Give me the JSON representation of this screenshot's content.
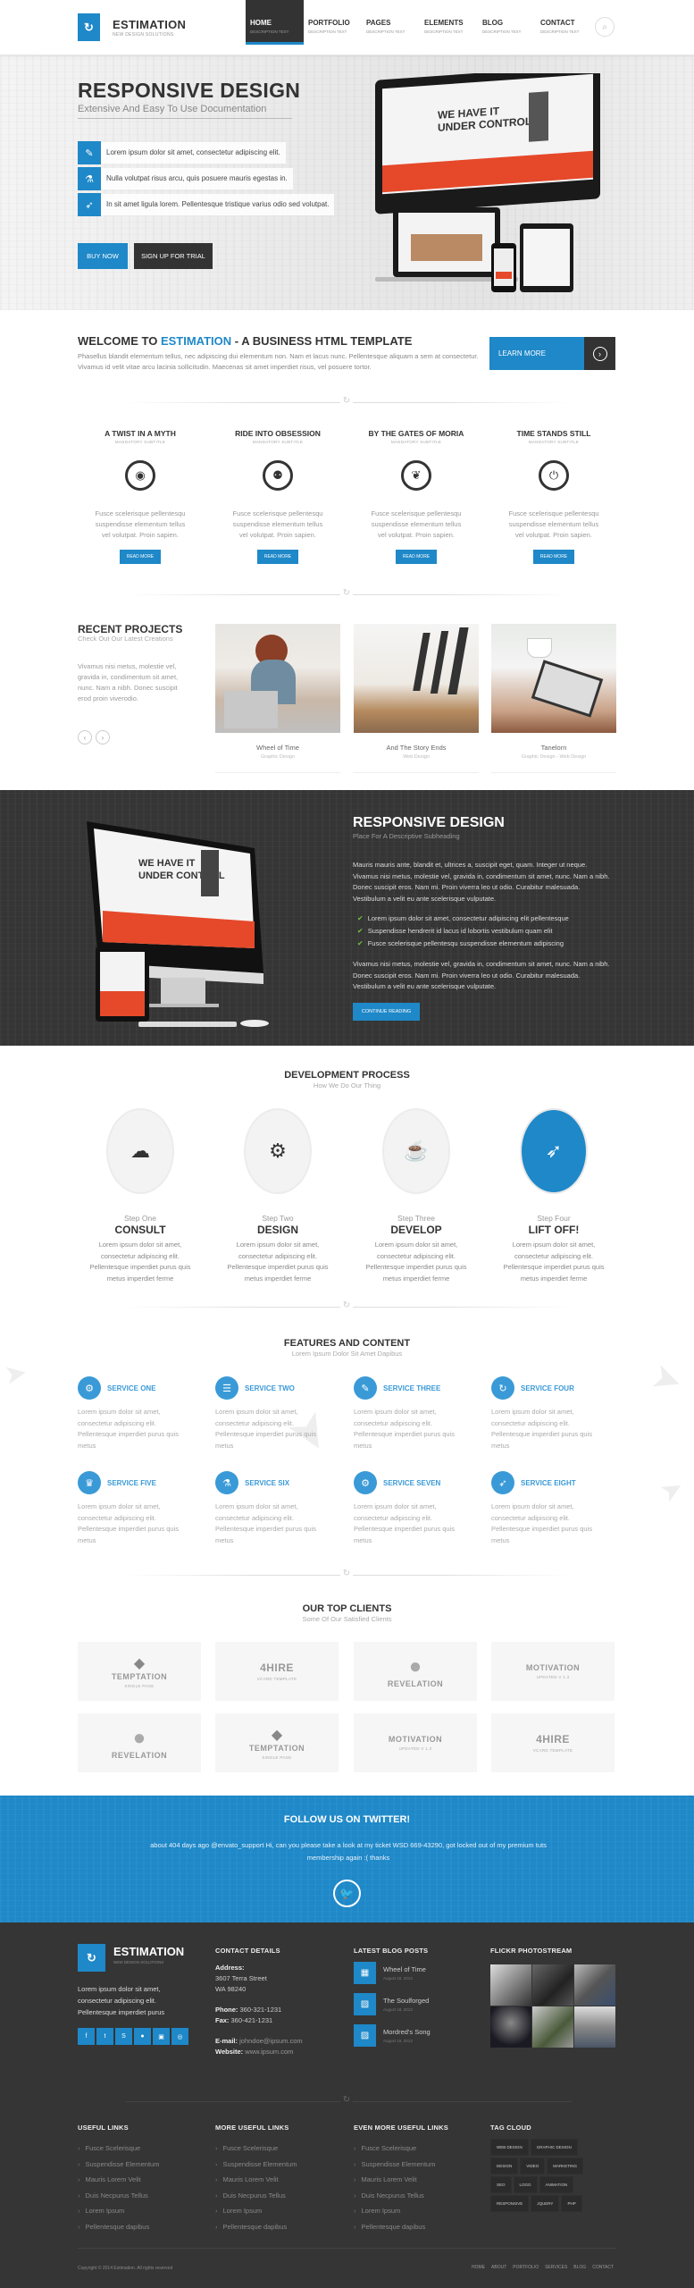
{
  "header": {
    "logo_name": "ESTIMATION",
    "logo_tagline": "NEW DESIGN SOLUTIONS",
    "nav": [
      {
        "label": "HOME",
        "desc": "DESCRIPTION TEXT",
        "active": true
      },
      {
        "label": "PORTFOLIO",
        "desc": "DESCRIPTION TEXT"
      },
      {
        "label": "PAGES",
        "desc": "DESCRIPTION TEXT"
      },
      {
        "label": "ELEMENTS",
        "desc": "DESCRIPTION TEXT"
      },
      {
        "label": "BLOG",
        "desc": "DESCRIPTION TEXT"
      },
      {
        "label": "CONTACT",
        "desc": "DESCRIPTION TEXT"
      }
    ],
    "search_icon": "search-icon"
  },
  "hero": {
    "title": "RESPONSIVE DESIGN",
    "subtitle": "Extensive And Easy To Use Documentation",
    "features": [
      {
        "icon": "pencil-icon",
        "text": "Lorem ipsum dolor sit amet, consectetur adipiscing elit."
      },
      {
        "icon": "flask-icon",
        "text": "Nulla volutpat risus arcu, quis posuere mauris egestas in."
      },
      {
        "icon": "rocket-icon",
        "text": "In sit amet ligula lorem. Pellentesque tristique varius odio sed volutpat."
      }
    ],
    "buy_label": "BUY NOW",
    "trial_label": "SIGN UP FOR TRIAL"
  },
  "welcome": {
    "title_pre": "WELCOME TO ",
    "title_brand": "ESTIMATION",
    "title_post": " - A BUSINESS HTML TEMPLATE",
    "text": "Phasellus blandit elementum tellus, nec adipiscing dui elementum non. Nam et lacus nunc. Pellentesque aliquam a sem at consectetur. Vivamus id velit vitae arcu lacinia sollicitudin. Maecenas sit amet imperdiet risus, vel posuere tortor.",
    "learn_more": "LEARN MORE"
  },
  "features": [
    {
      "title": "A TWIST IN A MYTH",
      "subtitle": "MANDATORY SUBTITLE",
      "icon": "globe-icon",
      "glyph": "◉",
      "text": "Fusce scelerisque pellentesqu suspendisse elementum tellus vel volutpat. Proin sapien.",
      "button": "READ MORE"
    },
    {
      "title": "RIDE INTO OBSESSION",
      "subtitle": "MANDATORY SUBTITLE",
      "icon": "group-icon",
      "glyph": "⚉",
      "text": "Fusce scelerisque pellentesqu suspendisse elementum tellus vel volutpat. Proin sapien.",
      "button": "READ MORE"
    },
    {
      "title": "BY THE GATES OF MORIA",
      "subtitle": "MANDATORY SUBTITLE",
      "icon": "leaf-icon",
      "glyph": "❦",
      "text": "Fusce scelerisque pellentesqu suspendisse elementum tellus vel volutpat. Proin sapien.",
      "button": "READ MORE"
    },
    {
      "title": "TIME STANDS STILL",
      "subtitle": "MANDATORY SUBTITLE",
      "icon": "power-icon",
      "glyph": "⏻",
      "text": "Fusce scelerisque pellentesqu suspendisse elementum tellus vel volutpat. Proin sapien.",
      "button": "READ MORE"
    }
  ],
  "projects": {
    "title": "RECENT PROJECTS",
    "subtitle": "Check Out Our Latest Creations",
    "text": "Vivamus nisi metus, molestie vel, gravida in, condimentum sit amet, nunc. Nam a nibh. Donec suscipit erod proin viverodio.",
    "prev": "‹",
    "next": "›",
    "items": [
      {
        "name": "Wheel of Time",
        "category": "Graphic Design"
      },
      {
        "name": "And The Story Ends",
        "category": "Web Design"
      },
      {
        "name": "Tanelorn",
        "category": "Graphic Design - Web Design"
      }
    ]
  },
  "dark": {
    "title": "RESPONSIVE DESIGN",
    "subtitle": "Place For A Descriptive Subheading",
    "p1": "Mauris mauris ante, blandit et, ultrices a, suscipit eget, quam. Integer ut neque. Vivamus nisi metus, molestie vel, gravida in, condimentum sit amet, nunc. Nam a nibh. Donec suscipit eros. Nam mi. Proin viverra leo ut odio. Curabitur malesuada. Vestibulum a velit eu ante scelerisque vulputate.",
    "list": [
      "Lorem ipsum dolor sit amet, consectetur adipiscing elit pellentesque",
      "Suspendisse hendrerit id lacus id lobortis vestibulum quam elit",
      "Fusce scelerisque pellentesqu suspendisse elementum adipiscing"
    ],
    "p2": "Vivamus nisi metus, molestie vel, gravida in, condimentum sit amet, nunc. Nam a nibh. Donec suscipit eros. Nam mi. Proin viverra leo ut odio. Curabitur malesuada. Vestibulum a velit eu ante scelerisque vulputate.",
    "button": "CONTINUE READING"
  },
  "process": {
    "title": "DEVELOPMENT PROCESS",
    "subtitle": "How We Do Our Thing",
    "steps": [
      {
        "num": "Step One",
        "title": "CONSULT",
        "icon": "cloud-icon",
        "glyph": "☁",
        "text": "Lorem ipsum dolor sit amet, consectetur adipiscing elit. Pellentesque imperdiet purus quis metus imperdiet ferme"
      },
      {
        "num": "Step Two",
        "title": "DESIGN",
        "icon": "gears-icon",
        "glyph": "⚙",
        "text": "Lorem ipsum dolor sit amet, consectetur adipiscing elit. Pellentesque imperdiet purus quis metus imperdiet ferme"
      },
      {
        "num": "Step Three",
        "title": "DEVELOP",
        "icon": "coffee-icon",
        "glyph": "☕",
        "text": "Lorem ipsum dolor sit amet, consectetur adipiscing elit. Pellentesque imperdiet purus quis metus imperdiet ferme"
      },
      {
        "num": "Step Four",
        "title": "LIFT OFF!",
        "icon": "rocket-icon",
        "glyph": "🚀",
        "text": "Lorem ipsum dolor sit amet, consectetur adipiscing elit. Pellentesque imperdiet purus quis metus imperdiet ferme"
      }
    ]
  },
  "services": {
    "title": "FEATURES AND CONTENT",
    "subtitle": "Lorem Ipsum Dolor Sit Amet Dapibus",
    "items": [
      {
        "title": "SERVICE ONE",
        "icon": "gear-icon",
        "glyph": "⚙",
        "text": "Lorem ipsum dolor sit amet, consectetur adipiscing elit. Pellentesque imperdiet purus quis metus"
      },
      {
        "title": "SERVICE TWO",
        "icon": "list-icon",
        "glyph": "☰",
        "text": "Lorem ipsum dolor sit amet, consectetur adipiscing elit. Pellentesque imperdiet purus quis metus"
      },
      {
        "title": "SERVICE THREE",
        "icon": "pencil-icon",
        "glyph": "✎",
        "text": "Lorem ipsum dolor sit amet, consectetur adipiscing elit. Pellentesque imperdiet purus quis metus"
      },
      {
        "title": "SERVICE FOUR",
        "icon": "refresh-icon",
        "glyph": "↻",
        "text": "Lorem ipsum dolor sit amet, consectetur adipiscing elit. Pellentesque imperdiet purus quis metus"
      },
      {
        "title": "SERVICE FIVE",
        "icon": "trophy-icon",
        "glyph": "♛",
        "text": "Lorem ipsum dolor sit amet, consectetur adipiscing elit. Pellentesque imperdiet purus quis metus"
      },
      {
        "title": "SERVICE SIX",
        "icon": "flask-icon",
        "glyph": "⚗",
        "text": "Lorem ipsum dolor sit amet, consectetur adipiscing elit. Pellentesque imperdiet purus quis metus"
      },
      {
        "title": "SERVICE SEVEN",
        "icon": "cogs-icon",
        "glyph": "⚙",
        "text": "Lorem ipsum dolor sit amet, consectetur adipiscing elit. Pellentesque imperdiet purus quis metus"
      },
      {
        "title": "SERVICE EIGHT",
        "icon": "rocket-icon",
        "glyph": "➶",
        "text": "Lorem ipsum dolor sit amet, consectetur adipiscing elit. Pellentesque imperdiet purus quis metus"
      }
    ]
  },
  "clients": {
    "title": "OUR TOP CLIENTS",
    "subtitle": "Some Of Our Satisfied Clients",
    "items": [
      {
        "name": "TEMPTATION",
        "tag": "SINGLE PAGE",
        "logo": "◆"
      },
      {
        "name": "4HIRE",
        "tag": "VCARD TEMPLATE",
        "logo": ""
      },
      {
        "name": "REVELATION",
        "tag": "",
        "logo": "●"
      },
      {
        "name": "MOTIVATION",
        "tag": "UPDATED V 1.3",
        "logo": ""
      },
      {
        "name": "REVELATION",
        "tag": "",
        "logo": "●"
      },
      {
        "name": "TEMPTATION",
        "tag": "SINGLE PAGE",
        "logo": "◆"
      },
      {
        "name": "MOTIVATION",
        "tag": "UPDATED V 1.3",
        "logo": ""
      },
      {
        "name": "4HIRE",
        "tag": "VCARD TEMPLATE",
        "logo": ""
      }
    ]
  },
  "twitter": {
    "title": "FOLLOW US ON TWITTER!",
    "tweet": "about 404 days ago @envato_support Hi, can you please take a look at my ticket WSD 669-43290, got locked out of my premium tuts membership again :( thanks",
    "icon": "twitter-icon"
  },
  "footer": {
    "logo_name": "ESTIMATION",
    "logo_tagline": "NEW DESIGN SOLUTIONS",
    "about": "Lorem ipsum dolor sit amet, consectetur adipiscing elit. Pellentesque imperdiet purus",
    "social": [
      {
        "icon": "facebook-icon",
        "glyph": "f"
      },
      {
        "icon": "twitter-icon",
        "glyph": "t"
      },
      {
        "icon": "skype-icon",
        "glyph": "S"
      },
      {
        "icon": "flickr-icon",
        "glyph": "●"
      },
      {
        "icon": "instagram-icon",
        "glyph": "▣"
      },
      {
        "icon": "dribbble-icon",
        "glyph": "◎"
      }
    ],
    "contact": {
      "title": "CONTACT DETAILS",
      "address_label": "Address:",
      "address_1": "3607 Terra Street",
      "address_2": "WA 98240",
      "phone_label": "Phone:",
      "phone": "360-321-1231",
      "fax_label": "Fax:",
      "fax": "360-421-1231",
      "email_label": "E-mail:",
      "email": "johndoe@ipsum.com",
      "website_label": "Website:",
      "website": "www.ipsum.com"
    },
    "blog": {
      "title": "LATEST BLOG POSTS",
      "posts": [
        {
          "title": "Wheel of Time",
          "date": "August 18, 2013",
          "icon": "film-icon",
          "glyph": "▦"
        },
        {
          "title": "The Soulforged",
          "date": "August 18, 2013",
          "icon": "image-icon",
          "glyph": "▨"
        },
        {
          "title": "Mordred's Song",
          "date": "August 18, 2013",
          "icon": "image-icon",
          "glyph": "▨"
        }
      ]
    },
    "flickr_title": "FLICKR PHOTOSTREAM",
    "links": [
      {
        "title": "USEFUL LINKS",
        "items": [
          "Fusce Scelerisque",
          "Suspendisse Elementum",
          "Mauris Lorem Velit",
          "Duis Necpurus Tellus",
          "Lorem Ipsum",
          "Pellentesque dapibus"
        ]
      },
      {
        "title": "MORE USEFUL LINKS",
        "items": [
          "Fusce Scelerisque",
          "Suspendisse Elementum",
          "Mauris Lorem Velit",
          "Duis Necpurus Tellus",
          "Lorem Ipsum",
          "Pellentesque dapibus"
        ]
      },
      {
        "title": "EVEN MORE USEFUL LINKS",
        "items": [
          "Fusce Scelerisque",
          "Suspendisse Elementum",
          "Mauris Lorem Velit",
          "Duis Necpurus Tellus",
          "Lorem Ipsum",
          "Pellentesque dapibus"
        ]
      }
    ],
    "tags_title": "TAG CLOUD",
    "tags": [
      "WEB DESIGN",
      "GRAPHIC DESIGN",
      "DESIGN",
      "VIDEO",
      "MARKETING",
      "SEO",
      "LOGO",
      "ANIMATION",
      "RESPONSIVE",
      "JQUERY",
      "PHP"
    ],
    "copyright": "Copyright © 2014 Estimation. All rights reserved",
    "bottom_nav": [
      "HOME",
      "ABOUT",
      "PORTFOLIO",
      "SERVICES",
      "BLOG",
      "CONTACT"
    ]
  },
  "colors": {
    "accent": "#1e88c8",
    "dark": "#353535",
    "service": "#3a9ad7"
  }
}
